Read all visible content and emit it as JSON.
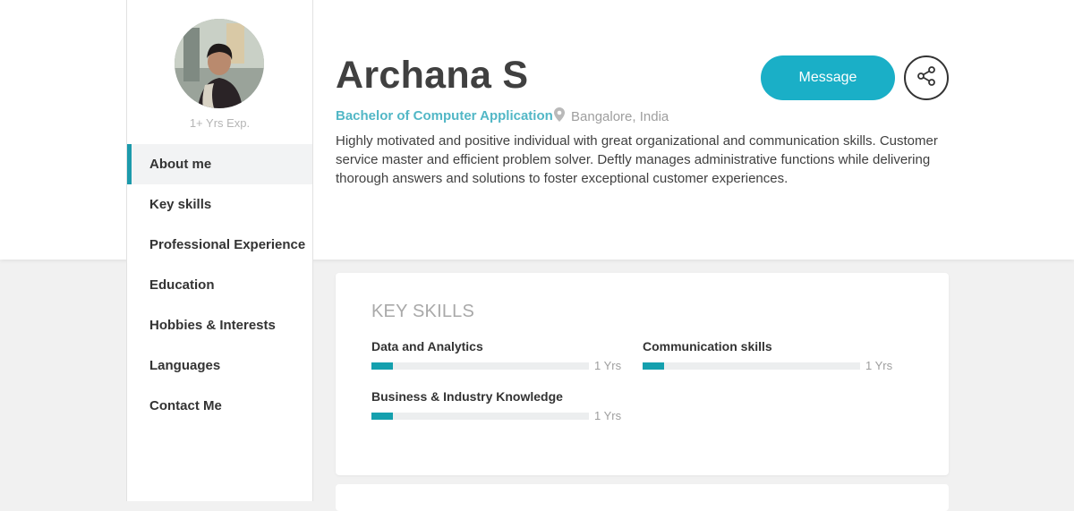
{
  "profile": {
    "experience": "1+ Yrs Exp.",
    "name": "Archana S",
    "degree": "Bachelor of Computer Application",
    "location": "Bangalore, India",
    "about": "Highly motivated and positive individual with great organizational and communication skills. Customer service master and efficient problem solver. Deftly manages administrative functions while delivering thorough answers and solutions to foster exceptional customer experiences."
  },
  "nav": {
    "items": [
      {
        "label": "About me",
        "active": true
      },
      {
        "label": "Key skills"
      },
      {
        "label": "Professional Experience"
      },
      {
        "label": "Education"
      },
      {
        "label": "Hobbies & Interests"
      },
      {
        "label": "Languages"
      },
      {
        "label": "Contact Me"
      }
    ]
  },
  "actions": {
    "message_label": "Message",
    "share_icon": "share-icon"
  },
  "key_skills": {
    "title": "KEY SKILLS",
    "skills": [
      {
        "name": "Data and Analytics",
        "years": "1 Yrs",
        "level": 0.1
      },
      {
        "name": "Communication skills",
        "years": "1 Yrs",
        "level": 0.1
      },
      {
        "name": "Business & Industry Knowledge",
        "years": "1 Yrs",
        "level": 0.1
      }
    ]
  },
  "colors": {
    "accent": "#1aafc7",
    "degree": "#52b7c6",
    "skill_fill": "#14a0ae",
    "active_border": "#1c9aab"
  }
}
